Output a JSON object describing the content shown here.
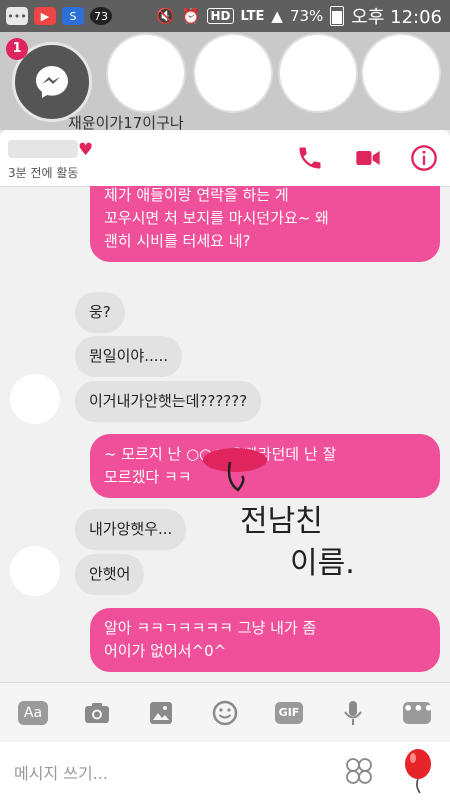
{
  "status_bar": {
    "icons": [
      "chat-icon",
      "youtube-icon",
      "sync-icon",
      "notification-73-icon"
    ],
    "notif_count": "73",
    "hd": "HD",
    "lte": "LTE",
    "battery": "73%",
    "time": "오후 12:06"
  },
  "background_header": {
    "badge_count": "1",
    "snippet": "재윤이가17이구나"
  },
  "chat_header": {
    "active_status": "3분 전에 활동",
    "colors": {
      "accent": "#e0245e"
    }
  },
  "messages": [
    {
      "side": "me",
      "text": "저 사람 저는 전 전 한 번도 한 적 없구요\n제가 애들이랑 연락을 하는 게\n꼬우시면 처 보지를 마시던가요~ 왜\n괜히 시비를 터세요 네?"
    },
    {
      "side": "them",
      "text": "웅?"
    },
    {
      "side": "them",
      "text": "뭔일이야....."
    },
    {
      "side": "them",
      "text": "이거내가안햇는데??????"
    },
    {
      "side": "me",
      "text": "~ 모르지 난 ○○○ 오빠라던데 난 잘\n모르겠다 ㅋㅋ"
    },
    {
      "side": "them",
      "text": "내가앙햇우..."
    },
    {
      "side": "them",
      "text": "안햇어"
    },
    {
      "side": "me",
      "text": "알아 ㅋㅋㄱㅋㅋㅋㅋ 그냥 내가 좀\n어이가 없어서^0^"
    }
  ],
  "annotation": {
    "line1": "전남친",
    "line2": "이름."
  },
  "toolbar": {
    "aa": "Aa",
    "gif": "GIF",
    "more": "•••"
  },
  "composer": {
    "placeholder": "메시지 쓰기..."
  }
}
